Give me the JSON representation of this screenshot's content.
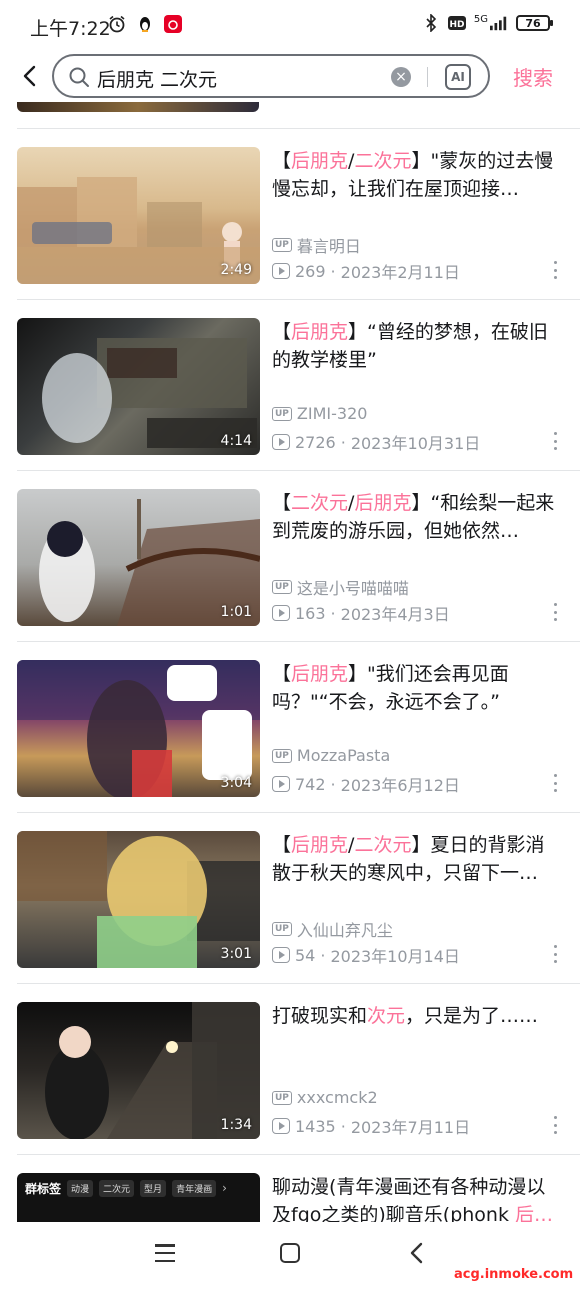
{
  "status_bar": {
    "time": "上午7:22",
    "network": "5G",
    "battery": "76"
  },
  "header": {
    "search_query": "后朋克 二次元",
    "ai_label": "AI",
    "search_button": "搜索"
  },
  "videos": [
    {
      "title_parts": [
        {
          "text": "【",
          "hl": false
        },
        {
          "text": "后朋克",
          "hl": true
        },
        {
          "text": "/",
          "hl": false
        },
        {
          "text": "二次元",
          "hl": true
        },
        {
          "text": "】\"蒙灰的过去慢慢忘却，让我们在屋顶迎接…",
          "hl": false
        }
      ],
      "duration": "2:49",
      "uploader": "暮言明日",
      "views": "269",
      "date": "2023年2月11日"
    },
    {
      "title_parts": [
        {
          "text": "【",
          "hl": false
        },
        {
          "text": "后朋克",
          "hl": true
        },
        {
          "text": "】“曾经的梦想，在破旧的教学楼里”",
          "hl": false
        }
      ],
      "duration": "4:14",
      "uploader": "ZIMI-320",
      "views": "2726",
      "date": "2023年10月31日"
    },
    {
      "title_parts": [
        {
          "text": "【",
          "hl": false
        },
        {
          "text": "二次元",
          "hl": true
        },
        {
          "text": "/",
          "hl": false
        },
        {
          "text": "后朋克",
          "hl": true
        },
        {
          "text": "】“和绘梨一起来到荒废的游乐园，但她依然…",
          "hl": false
        }
      ],
      "duration": "1:01",
      "uploader": "这是小号喵喵喵",
      "views": "163",
      "date": "2023年4月3日"
    },
    {
      "title_parts": [
        {
          "text": "【",
          "hl": false
        },
        {
          "text": "后朋克",
          "hl": true
        },
        {
          "text": "】\"我们还会再见面吗？\"“不会，永远不会了。”",
          "hl": false
        }
      ],
      "duration": "3:04",
      "uploader": "MozzaPasta",
      "views": "742",
      "date": "2023年6月12日"
    },
    {
      "title_parts": [
        {
          "text": "【",
          "hl": false
        },
        {
          "text": "后朋克",
          "hl": true
        },
        {
          "text": "/",
          "hl": false
        },
        {
          "text": "二次元",
          "hl": true
        },
        {
          "text": "】夏日的背影消散于秋天的寒风中，只留下一…",
          "hl": false
        }
      ],
      "duration": "3:01",
      "uploader": "入仙山弃凡尘",
      "views": "54",
      "date": "2023年10月14日"
    },
    {
      "title_parts": [
        {
          "text": "打破现实和",
          "hl": false
        },
        {
          "text": "次元",
          "hl": true
        },
        {
          "text": "，只是为了……",
          "hl": false
        }
      ],
      "duration": "1:34",
      "uploader": "xxxcmck2",
      "views": "1435",
      "date": "2023年7月11日"
    },
    {
      "title_parts": [
        {
          "text": "聊动漫(青年漫画还有各种动漫以及fgo之类的)聊音乐(phonk ",
          "hl": false
        },
        {
          "text": "后…",
          "hl": true
        }
      ],
      "thumb_tags": {
        "head": "群标签",
        "chips": [
          "动漫",
          "二次元",
          "型月",
          "青年漫画"
        ]
      }
    }
  ],
  "watermark": "acg.inmoke.com",
  "colors": {
    "accent": "#fb7299",
    "meta": "#9499a0",
    "text": "#18191c"
  }
}
